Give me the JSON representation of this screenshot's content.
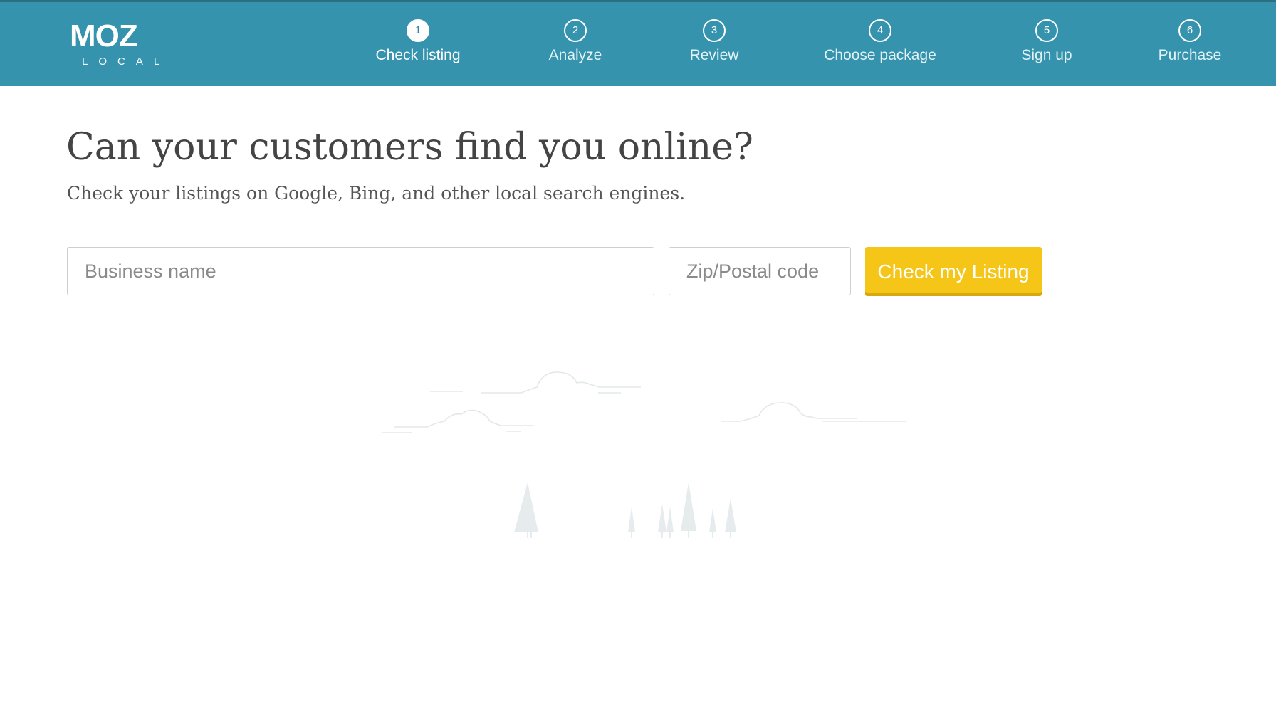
{
  "brand": {
    "logo_text": "MOZ",
    "logo_subtext": "LOCAL"
  },
  "steps": [
    {
      "number": "1",
      "label": "Check listing",
      "active": true
    },
    {
      "number": "2",
      "label": "Analyze",
      "active": false
    },
    {
      "number": "3",
      "label": "Review",
      "active": false
    },
    {
      "number": "4",
      "label": "Choose package",
      "active": false
    },
    {
      "number": "5",
      "label": "Sign up",
      "active": false
    },
    {
      "number": "6",
      "label": "Purchase",
      "active": false
    }
  ],
  "main": {
    "headline": "Can your customers find you online?",
    "subheadline": "Check your listings on Google, Bing, and other local search engines.",
    "business_name_placeholder": "Business name",
    "business_name_value": "",
    "zip_placeholder": "Zip/Postal code",
    "zip_value": "",
    "submit_label": "Check my Listing"
  },
  "colors": {
    "header_bg": "#3593ad",
    "button_bg": "#f5c518",
    "illustration": "#e3e8ea"
  },
  "icons": {
    "cloud": "cloud-icon",
    "tree": "tree-icon"
  }
}
